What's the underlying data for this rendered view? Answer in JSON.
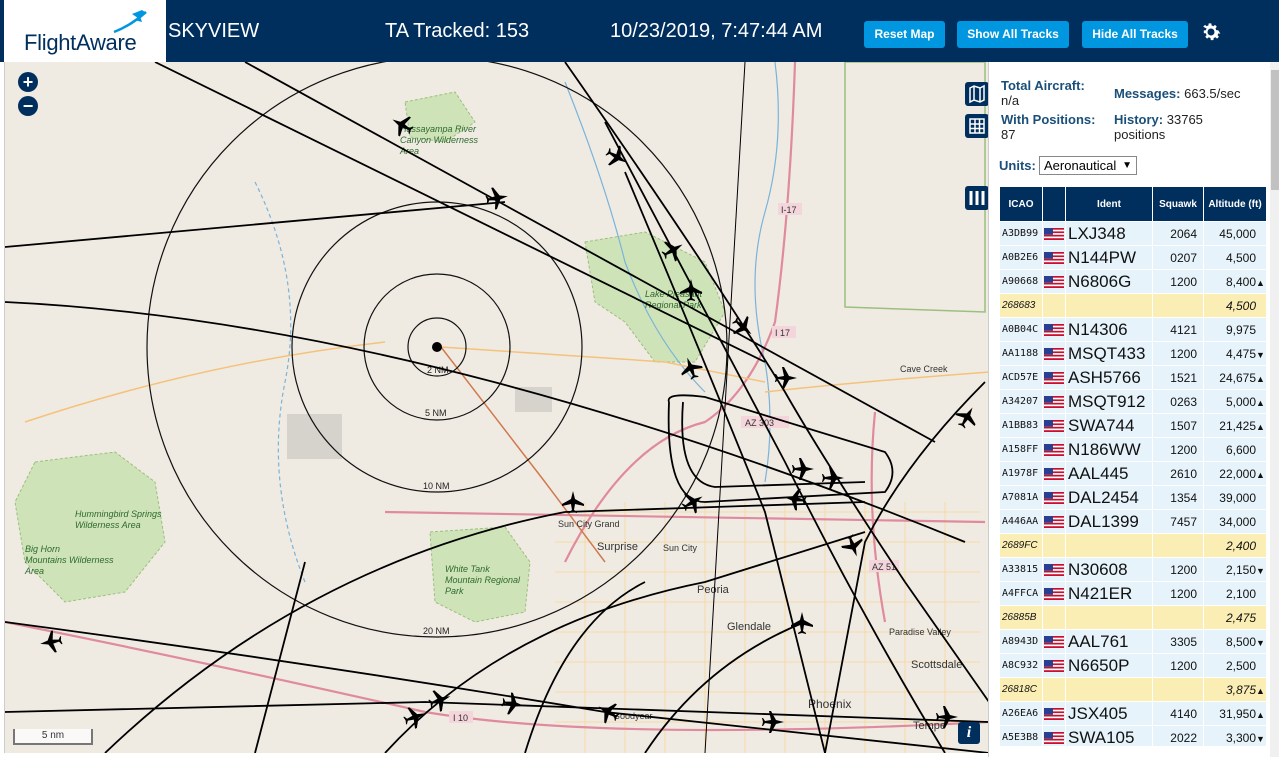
{
  "header": {
    "logo_text": "FlightAware",
    "title": "SKYVIEW",
    "tracked": "TA Tracked: 153",
    "timestamp": "10/23/2019, 7:47:44 AM",
    "reset_map": "Reset Map",
    "show_all": "Show All Tracks",
    "hide_all": "Hide All Tracks"
  },
  "map": {
    "zoom_in": "+",
    "zoom_out": "−",
    "scale": "5 nm",
    "info": "i",
    "range_rings": [
      "2 NM",
      "5 NM",
      "10 NM",
      "20 NM"
    ],
    "places": [
      "Hassayampa River Canyon Wilderness Area",
      "Lake Pleasant Regional Park",
      "Cave Creek",
      "Hummingbird Springs Wilderness Area",
      "Big Horn Mountains Wilderness Area",
      "White Tank Mountain Regional Park",
      "Sun City Grand",
      "Surprise",
      "Sun City",
      "Peoria",
      "Glendale",
      "Paradise Valley",
      "Scottsdale",
      "Phoenix",
      "Goodyear",
      "Tempe"
    ],
    "roads": [
      "I-17",
      "I 17",
      "AZ 303",
      "AZ 51",
      "I 10"
    ],
    "colors": {
      "land": "#efebe3",
      "park": "#cfe3b8",
      "river": "#7ab3da",
      "highway": "#e08a9e",
      "minor_road": "#f5c27a",
      "track": "#000000"
    }
  },
  "panel": {
    "total_aircraft_label": "Total Aircraft:",
    "total_aircraft": "n/a",
    "messages_label": "Messages:",
    "messages": "663.5/sec",
    "with_positions_label": "With Positions:",
    "with_positions": "87",
    "history_label": "History:",
    "history": "33765 positions",
    "units_label": "Units:",
    "units_value": "Aeronautical",
    "columns": [
      "ICAO",
      "",
      "Ident",
      "Squawk",
      "Altitude (ft)"
    ],
    "rows": [
      {
        "icao": "A3DB99",
        "flag": true,
        "ident": "LXJ348",
        "squawk": "2064",
        "alt": "45,000",
        "trend": "",
        "hl": false
      },
      {
        "icao": "A0B2E6",
        "flag": true,
        "ident": "N144PW",
        "squawk": "0207",
        "alt": "4,500",
        "trend": "",
        "hl": false
      },
      {
        "icao": "A90668",
        "flag": true,
        "ident": "N6806G",
        "squawk": "1200",
        "alt": "8,400",
        "trend": "▲",
        "hl": false
      },
      {
        "icao": "268683",
        "flag": false,
        "ident": "",
        "squawk": "",
        "alt": "4,500",
        "trend": "",
        "hl": true
      },
      {
        "icao": "A0B04C",
        "flag": true,
        "ident": "N14306",
        "squawk": "4121",
        "alt": "9,975",
        "trend": "",
        "hl": false
      },
      {
        "icao": "AA1188",
        "flag": true,
        "ident": "MSQT433",
        "squawk": "1200",
        "alt": "4,475",
        "trend": "▼",
        "hl": false
      },
      {
        "icao": "ACD57E",
        "flag": true,
        "ident": "ASH5766",
        "squawk": "1521",
        "alt": "24,675",
        "trend": "▲",
        "hl": false
      },
      {
        "icao": "A34207",
        "flag": true,
        "ident": "MSQT912",
        "squawk": "0263",
        "alt": "5,000",
        "trend": "▲",
        "hl": false
      },
      {
        "icao": "A1BB83",
        "flag": true,
        "ident": "SWA744",
        "squawk": "1507",
        "alt": "21,425",
        "trend": "▲",
        "hl": false
      },
      {
        "icao": "A158FF",
        "flag": true,
        "ident": "N186WW",
        "squawk": "1200",
        "alt": "6,600",
        "trend": "",
        "hl": false
      },
      {
        "icao": "A1978F",
        "flag": true,
        "ident": "AAL445",
        "squawk": "2610",
        "alt": "22,000",
        "trend": "▲",
        "hl": false
      },
      {
        "icao": "A7081A",
        "flag": true,
        "ident": "DAL2454",
        "squawk": "1354",
        "alt": "39,000",
        "trend": "",
        "hl": false
      },
      {
        "icao": "A446AA",
        "flag": true,
        "ident": "DAL1399",
        "squawk": "7457",
        "alt": "34,000",
        "trend": "",
        "hl": false
      },
      {
        "icao": "2689FC",
        "flag": false,
        "ident": "",
        "squawk": "",
        "alt": "2,400",
        "trend": "",
        "hl": true
      },
      {
        "icao": "A33815",
        "flag": true,
        "ident": "N30608",
        "squawk": "1200",
        "alt": "2,150",
        "trend": "▼",
        "hl": false
      },
      {
        "icao": "A4FFCA",
        "flag": true,
        "ident": "N421ER",
        "squawk": "1200",
        "alt": "2,100",
        "trend": "",
        "hl": false
      },
      {
        "icao": "26885B",
        "flag": false,
        "ident": "",
        "squawk": "",
        "alt": "2,475",
        "trend": "",
        "hl": true
      },
      {
        "icao": "A8943D",
        "flag": true,
        "ident": "AAL761",
        "squawk": "3305",
        "alt": "8,500",
        "trend": "▼",
        "hl": false
      },
      {
        "icao": "A8C932",
        "flag": true,
        "ident": "N6650P",
        "squawk": "1200",
        "alt": "2,500",
        "trend": "",
        "hl": false
      },
      {
        "icao": "26818C",
        "flag": false,
        "ident": "",
        "squawk": "",
        "alt": "3,875",
        "trend": "▲",
        "hl": true
      },
      {
        "icao": "A26EA6",
        "flag": true,
        "ident": "JSX405",
        "squawk": "4140",
        "alt": "31,950",
        "trend": "▲",
        "hl": false
      },
      {
        "icao": "A5E3B8",
        "flag": true,
        "ident": "SWA105",
        "squawk": "2022",
        "alt": "3,300",
        "trend": "▼",
        "hl": false
      }
    ]
  }
}
